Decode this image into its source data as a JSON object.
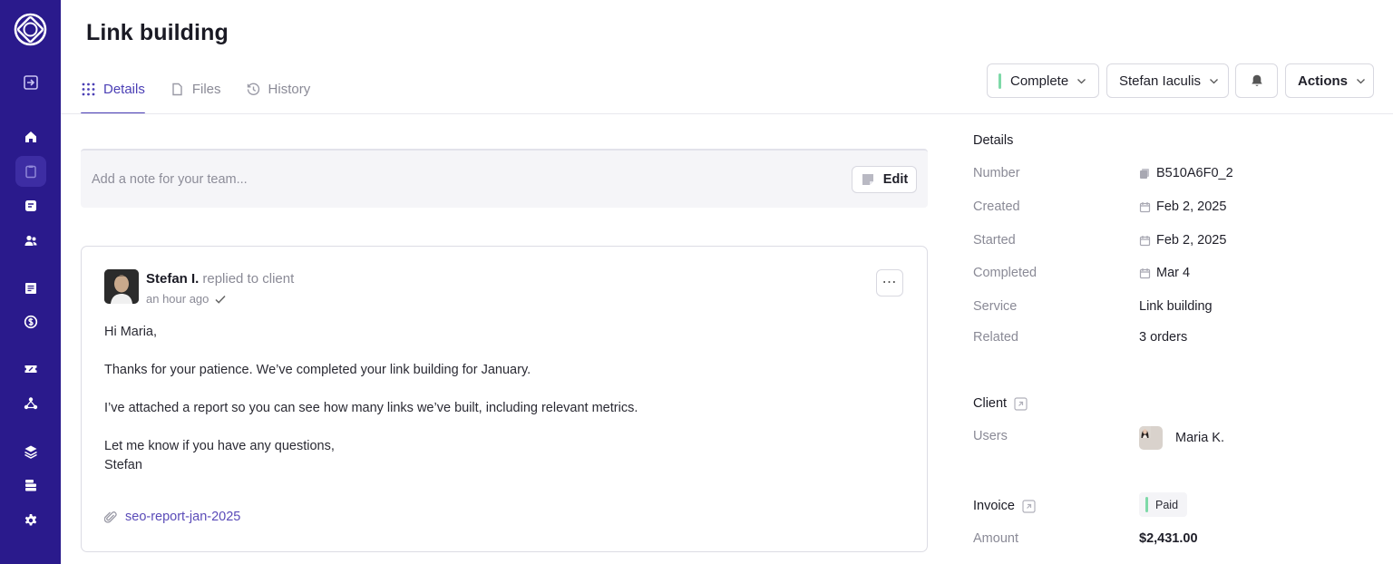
{
  "page": {
    "title": "Link building"
  },
  "tabs": [
    {
      "label": "Details",
      "icon": "grid-icon",
      "active": true
    },
    {
      "label": "Files",
      "icon": "file-icon",
      "active": false
    },
    {
      "label": "History",
      "icon": "history-icon",
      "active": false
    }
  ],
  "header_actions": {
    "status_label": "Complete",
    "status_color": "#7ed9a8",
    "assignee_label": "Stefan Iaculis",
    "actions_label": "Actions"
  },
  "note": {
    "placeholder": "Add a note for your team...",
    "edit_label": "Edit"
  },
  "message": {
    "author": "Stefan I.",
    "action": "replied to client",
    "time": "an hour ago",
    "lines": [
      "Hi Maria,",
      "Thanks for your patience. We’ve completed your link building for January.",
      "I’ve attached a report so you can see how many links we’ve built, including relevant metrics.",
      "Let me know if you have any questions,",
      "Stefan"
    ],
    "attachment": "seo-report-jan-2025"
  },
  "details": {
    "heading": "Details",
    "rows": [
      {
        "label": "Number",
        "value": "B510A6F0_2",
        "icon": "copy-icon"
      },
      {
        "label": "Created",
        "value": "Feb 2, 2025",
        "icon": "calendar-icon"
      },
      {
        "label": "Started",
        "value": "Feb 2, 2025",
        "icon": "calendar-icon"
      },
      {
        "label": "Completed",
        "value": "Mar 4",
        "icon": "calendar-icon"
      },
      {
        "label": "Service",
        "value": "Link building"
      },
      {
        "label": "Related",
        "value": "3 orders"
      }
    ]
  },
  "client": {
    "heading": "Client",
    "users_label": "Users",
    "user_name": "Maria K."
  },
  "invoice": {
    "heading": "Invoice",
    "status": "Paid",
    "amount_label": "Amount",
    "amount": "$2,431.00"
  },
  "colors": {
    "sidebar": "#2a1a8c",
    "accent": "#4b3fb5",
    "paid": "#7ed9a8"
  }
}
